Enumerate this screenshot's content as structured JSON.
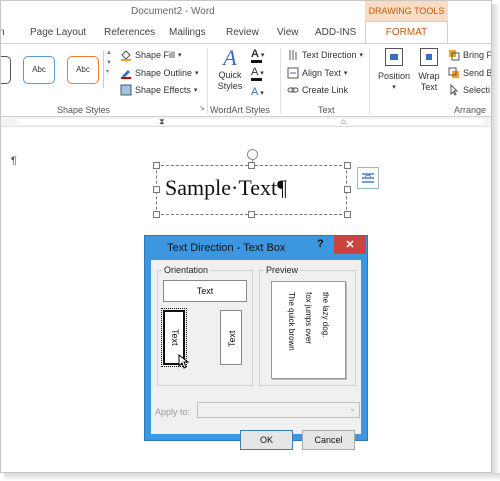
{
  "window": {
    "title": "Document2 - Word"
  },
  "contextual_tab_group": "DRAWING TOOLS",
  "tabs": [
    "n",
    "Page Layout",
    "References",
    "Mailings",
    "Review",
    "View",
    "ADD-INS",
    "FORMAT"
  ],
  "ribbon": {
    "shape_styles": {
      "thumb1": "Abc",
      "thumb2": "Abc",
      "fill": "Shape Fill",
      "outline": "Shape Outline",
      "effects": "Shape Effects",
      "label": "Shape Styles"
    },
    "wordart_styles": {
      "quick_styles_line1": "Quick",
      "quick_styles_line2": "Styles",
      "label": "WordArt Styles"
    },
    "text": {
      "direction": "Text Direction",
      "align": "Align Text",
      "link": "Create Link",
      "label": "Text"
    },
    "arrange": {
      "position": "Position",
      "wrap_line1": "Wrap",
      "wrap_line2": "Text",
      "bring": "Bring F",
      "send": "Send B",
      "selection": "Selecti",
      "label": "Arrange"
    }
  },
  "document": {
    "paragraph_mark": "¶",
    "textbox_text": "Sample·Text¶"
  },
  "dialog": {
    "title": "Text Direction - Text Box",
    "help": "?",
    "close": "✕",
    "orientation_label": "Orientation",
    "preview_label": "Preview",
    "orient_horizontal": "Text",
    "orient_vertical_down": "Text",
    "orient_vertical_up": "Text",
    "preview_lines": [
      "The quick brown",
      "fox jumps over",
      "the lazy dog."
    ],
    "apply_to_label": "Apply to:",
    "ok": "OK",
    "cancel": "Cancel"
  },
  "colors": {
    "accent_orange": "#c55a11",
    "dialog_blue": "#3c96e0",
    "close_red": "#c9443f"
  }
}
